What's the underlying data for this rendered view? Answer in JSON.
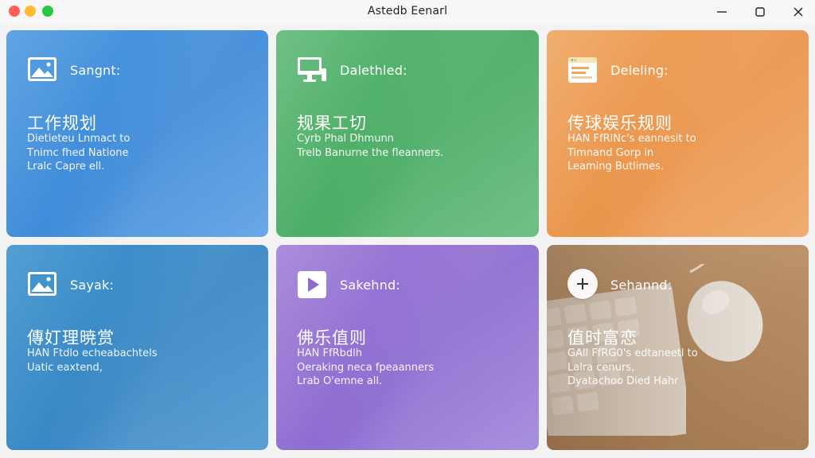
{
  "window": {
    "title": "Astedb Eenarl"
  },
  "tiles": [
    {
      "label": "Sangnt:",
      "heading": "工作规划",
      "desc": [
        "Dietieteu Lnmact to",
        "Tnimc fhed Natione",
        "Lralc Capre ell."
      ],
      "icon": "image-icon",
      "color": "#4f9ae0"
    },
    {
      "label": "Dalethled:",
      "heading": "规果工切",
      "desc": [
        "Cyrb Phal Dhmunn",
        "Trelb Banurne the fleanners."
      ],
      "icon": "computer-icon",
      "color": "#5fb978"
    },
    {
      "label": "Deleling:",
      "heading": "传球娱乐规则",
      "desc": [
        "HAN FfRlNc's eannesit to",
        "Timnand Gorp in",
        "Leaming Butlimes."
      ],
      "icon": "browser-window-icon",
      "color": "#efa661"
    },
    {
      "label": "Sayak:",
      "heading": "傳奵理暁赏",
      "desc": [
        "HAN Ftdlo echeabachtels",
        "Uatic eaxtend,"
      ],
      "icon": "image-icon",
      "color": "#3f94cf"
    },
    {
      "label": "Sakehnd:",
      "heading": "佛乐值则",
      "desc": [
        "HAN FfRbdlh",
        "Oeraking neca fpeaanners",
        "Lrab O'emne all."
      ],
      "icon": "play-icon",
      "color": "#a180d8"
    },
    {
      "label": "Sehannd:",
      "heading": "值时富恋",
      "desc": [
        "GAll FfRG0's edtaneetl to",
        "Lalra cenurs,",
        "Dyatachoo Died Hahr"
      ],
      "icon": "plus-icon",
      "color": "#c9a37d"
    }
  ]
}
